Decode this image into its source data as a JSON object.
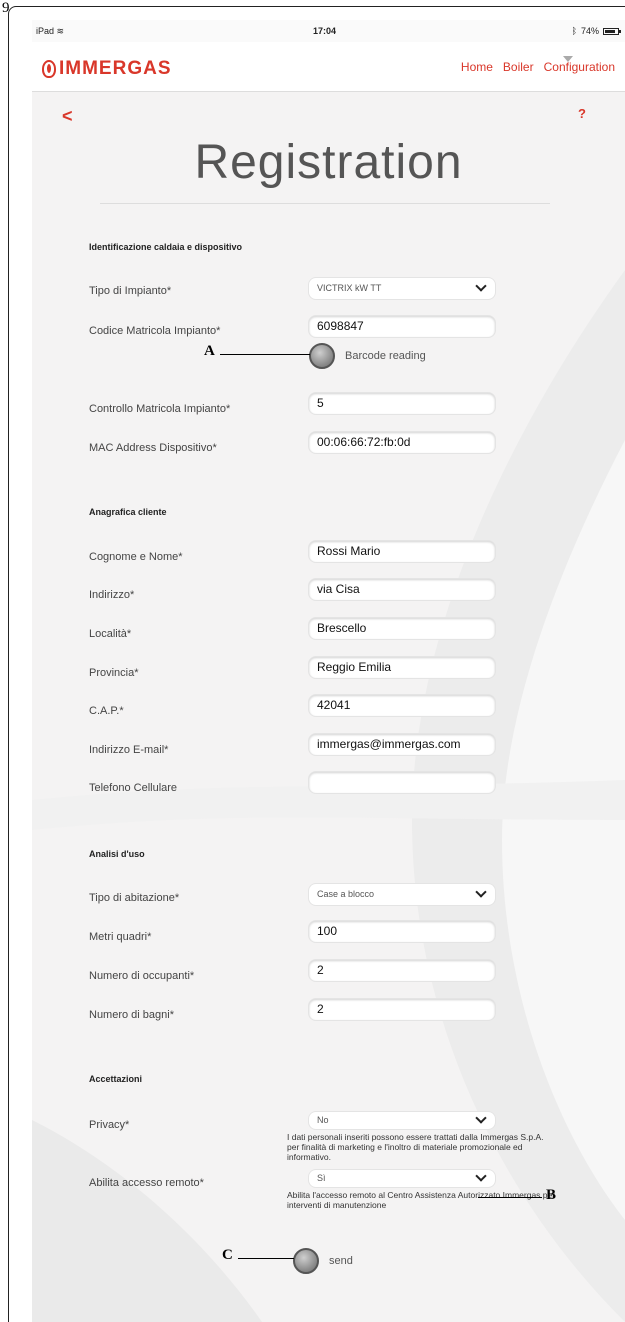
{
  "page_number": "9",
  "status_bar": {
    "device": "iPad",
    "wifi_icon": "wifi-icon",
    "time": "17:04",
    "bluetooth_icon": "bluetooth-icon",
    "battery": "74%"
  },
  "nav": {
    "brand": "IMMERGAS",
    "links": [
      "Home",
      "Boiler",
      "Configuration"
    ]
  },
  "page_title": "Registration",
  "help": "?",
  "back": "<",
  "sections": {
    "ident": "Identificazione caldaia e dispositivo",
    "anagrafica": "Anagrafica cliente",
    "analisi": "Analisi d'uso",
    "accettazioni": "Accettazioni"
  },
  "fields": {
    "tipo_impianto": {
      "label": "Tipo di Impianto*",
      "value": "VICTRIX kW TT"
    },
    "codice_matricola": {
      "label": "Codice Matricola Impianto*",
      "value": "6098847"
    },
    "barcode": {
      "label": "Barcode reading"
    },
    "controllo_matricola": {
      "label": "Controllo Matricola Impianto*",
      "value": "5"
    },
    "mac_address": {
      "label": "MAC Address Dispositivo*",
      "value": "00:06:66:72:fb:0d"
    },
    "cognome_nome": {
      "label": "Cognome e Nome*",
      "value": "Rossi Mario"
    },
    "indirizzo": {
      "label": "Indirizzo*",
      "value": "via Cisa"
    },
    "localita": {
      "label": "Località*",
      "value": "Brescello"
    },
    "provincia": {
      "label": "Provincia*",
      "value": "Reggio Emilia"
    },
    "cap": {
      "label": "C.A.P.*",
      "value": "42041"
    },
    "email": {
      "label": "Indirizzo E-mail*",
      "value": "immergas@immergas.com"
    },
    "telefono": {
      "label": "Telefono Cellulare",
      "value": ""
    },
    "tipo_abitazione": {
      "label": "Tipo di abitazione*",
      "value": "Case a blocco"
    },
    "metri_quadri": {
      "label": "Metri quadri*",
      "value": "100"
    },
    "occupanti": {
      "label": "Numero di occupanti*",
      "value": "2"
    },
    "bagni": {
      "label": "Numero di bagni*",
      "value": "2"
    },
    "privacy": {
      "label": "Privacy*",
      "value": "No",
      "note": "I dati personali inseriti possono essere trattati dalla Immergas S.p.A. per finalità di marketing e l'inoltro di materiale promozionale ed informativo."
    },
    "accesso_remoto": {
      "label": "Abilita accesso remoto*",
      "value": "Sì",
      "note": "Abilita l'accesso remoto al Centro Assistenza Autorizzato Immergas per interventi di manutenzione"
    }
  },
  "send": "send",
  "callouts": {
    "a": "A",
    "b": "B",
    "c": "C"
  },
  "colors": {
    "accent": "#d9372a",
    "background": "#f4f3f3"
  }
}
